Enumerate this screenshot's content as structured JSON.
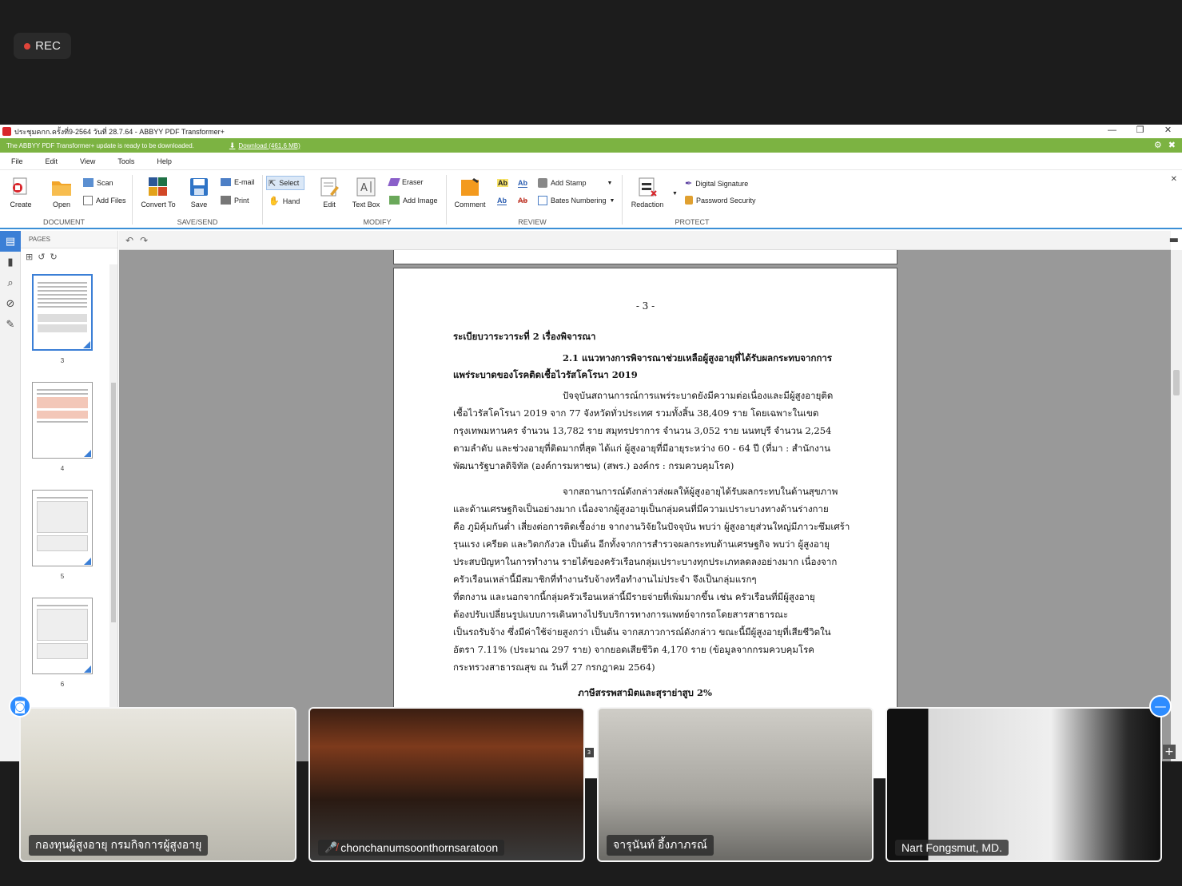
{
  "recording": {
    "label": "REC"
  },
  "window": {
    "title": "ประชุมคกก.ครั้งที่9-2564 วันที่ 28.7.64 - ABBYY PDF Transformer+",
    "minimize_icon": "—",
    "restore_icon": "❐",
    "close_icon": "✕"
  },
  "update": {
    "message": "The ABBYY PDF Transformer+ update is ready to be downloaded.",
    "download_label": "Download (461.6 MB)",
    "settings_icon": "⚙",
    "close_icon": "✖"
  },
  "menu": [
    "File",
    "Edit",
    "View",
    "Tools",
    "Help"
  ],
  "ribbon": {
    "document": {
      "create": "Create",
      "open": "Open",
      "scan": "Scan",
      "add_files": "Add Files",
      "group": "DOCUMENT"
    },
    "save_send": {
      "convert_to": "Convert To",
      "save": "Save",
      "email": "E-mail",
      "print": "Print",
      "group": "SAVE/SEND"
    },
    "modify": {
      "select": "Select",
      "hand": "Hand",
      "edit": "Edit",
      "text_box": "Text Box",
      "eraser": "Eraser",
      "add_image": "Add Image",
      "group": "MODIFY"
    },
    "review": {
      "comment": "Comment",
      "add_stamp": "Add Stamp",
      "bates_numbering": "Bates Numbering",
      "group": "REVIEW"
    },
    "protect": {
      "redaction": "Redaction",
      "digital_signature": "Digital Signature",
      "password_security": "Password Security",
      "group": "PROTECT"
    },
    "close_icon": "✕"
  },
  "pages_panel": {
    "header": "PAGES",
    "thumbnails": [
      "3",
      "4",
      "5",
      "6"
    ]
  },
  "document": {
    "page_number": "- 3 -",
    "lines": [
      "ระเบียบวาระวาระที่  2  เรื่องพิจารณา",
      "2.1  แนวทางการพิจารณาช่วยเหลือผู้สูงอายุที่ได้รับผลกระทบจากการ",
      "แพร่ระบาดของโรคติดเชื้อไวรัสโคโรนา 2019",
      "ปัจจุบันสถานการณ์การแพร่ระบาดยังมีความต่อเนื่องและมีผู้สูงอายุติด",
      "เชื้อไวรัสโคโรนา 2019 จาก 77 จังหวัดทั่วประเทศ รวมทั้งสิ้น 38,409 ราย โดยเฉพาะในเขต",
      "กรุงเทพมหานคร จำนวน 13,782 ราย  สมุทรปราการ จำนวน 3,052 ราย นนทบุรี จำนวน 2,254",
      "ตามลำดับ และช่วงอายุที่ติดมากที่สุด ได้แก่ ผู้สูงอายุที่มีอายุระหว่าง 60 - 64 ปี (ที่มา : สำนักงาน",
      "พัฒนารัฐบาลดิจิทัล (องค์การมหาชน) (สพร.) องค์กร : กรมควบคุมโรค)",
      "จากสถานการณ์ดังกล่าวส่งผลให้ผู้สูงอายุได้รับผลกระทบในด้านสุขภาพ",
      "และด้านเศรษฐกิจเป็นอย่างมาก เนื่องจากผู้สูงอายุเป็นกลุ่มคนที่มีความเปราะบางทางด้านร่างกาย",
      "คือ ภูมิคุ้มกันต่ำ เสี่ยงต่อการติดเชื้อง่าย จากงานวิจัยในปัจจุบัน พบว่า ผู้สูงอายุส่วนใหญ่มีภาวะซึมเศร้า",
      "รุนแรง เครียด และวิตกกังวล เป็นต้น อีกทั้งจากการสำรวจผลกระทบด้านเศรษฐกิจ พบว่า ผู้สูงอายุ",
      "ประสบปัญหาในการทำงาน รายได้ของครัวเรือนกลุ่มเปราะบางทุกประเภทลดลงอย่างมาก เนื่องจาก",
      "ครัวเรือนเหล่านี้มีสมาชิกที่ทำงานรับจ้างหรือทำงานไม่ประจำ จึงเป็นกลุ่มแรกๆ",
      "ที่ตกงาน และนอกจากนี้กลุ่มครัวเรือนเหล่านี้มีรายจ่ายที่เพิ่มมากขึ้น เช่น ครัวเรือนที่มีผู้สูงอายุ",
      "ต้องปรับเปลี่ยนรูปแบบการเดินทางไปรับบริการทางการแพทย์จากรถโดยสารสาธารณะ",
      "เป็นรถรับจ้าง ซึ่งมีค่าใช้จ่ายสูงกว่า เป็นต้น จากสภาวการณ์ดังกล่าว ขณะนี้มีผู้สูงอายุที่เสียชีวิตใน",
      "อัตรา 7.11% (ประมาณ 297 ราย) จากยอดเสียชีวิต 4,170 ราย (ข้อมูลจากกรมควบคุมโรค",
      "กระทรวงสาธารณสุข ณ วันที่ 27 กรกฎาคม 2564)",
      "ภาษีสรรพสามิตและสุราย่าสูบ 2%"
    ],
    "page_indicator": "3"
  },
  "participants": [
    {
      "name": "กองทุนผู้สูงอายุ กรมกิจการผู้สูงอายุ",
      "muted": false
    },
    {
      "name": "chonchanumsoonthornsaratoon",
      "muted": true
    },
    {
      "name": "จารุนันท์ อึ้งภาภรณ์",
      "muted": false
    },
    {
      "name": "Nart Fongsmut, MD.",
      "muted": false
    }
  ],
  "icons": {
    "plus": "+",
    "minus": "—"
  }
}
